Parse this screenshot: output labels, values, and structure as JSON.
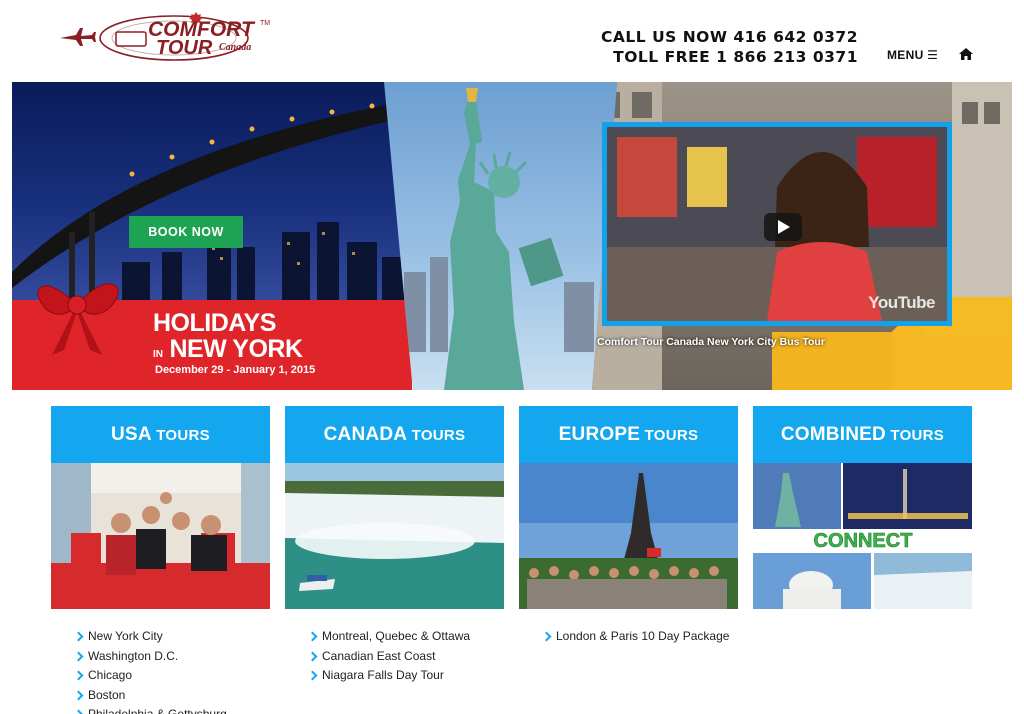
{
  "header": {
    "logo": {
      "word1": "COMFORT",
      "word2": "TOUR",
      "sub": "Canada",
      "tm": "TM"
    },
    "phone_line1": "CALL US NOW 416 642 0372",
    "phone_line2": "TOLL FREE 1 866 213 0371",
    "menu_label": "MENU ☰",
    "home_icon": "home-icon"
  },
  "hero": {
    "book_now": "BOOK NOW",
    "headline_1": "HOLIDAYS",
    "headline_in": "IN",
    "headline_2": "NEW YORK",
    "dates": "December 29 - January 1, 2015",
    "video_caption": "Comfort Tour Canada New York City Bus Tour",
    "video_brand": "YouTube"
  },
  "tours": [
    {
      "name_big": "USA",
      "name_small": "TOURS",
      "items": [
        "New York City",
        "Washington D.C.",
        "Chicago",
        "Boston",
        "Philadelphia & Gettysburg"
      ]
    },
    {
      "name_big": "CANADA",
      "name_small": "TOURS",
      "items": [
        "Montreal, Quebec & Ottawa",
        "Canadian East Coast",
        "Niagara Falls Day Tour"
      ]
    },
    {
      "name_big": "EUROPE",
      "name_small": "TOURS",
      "items": [
        "London & Paris 10 Day Package"
      ]
    },
    {
      "name_big": "COMBINED",
      "name_small": "TOURS",
      "connect_label": "CONNECT",
      "items": []
    }
  ],
  "colors": {
    "accent": "#14a7f0",
    "brand": "#8a1f24",
    "hero_red": "#e0252a",
    "book_green": "#1ea355"
  }
}
